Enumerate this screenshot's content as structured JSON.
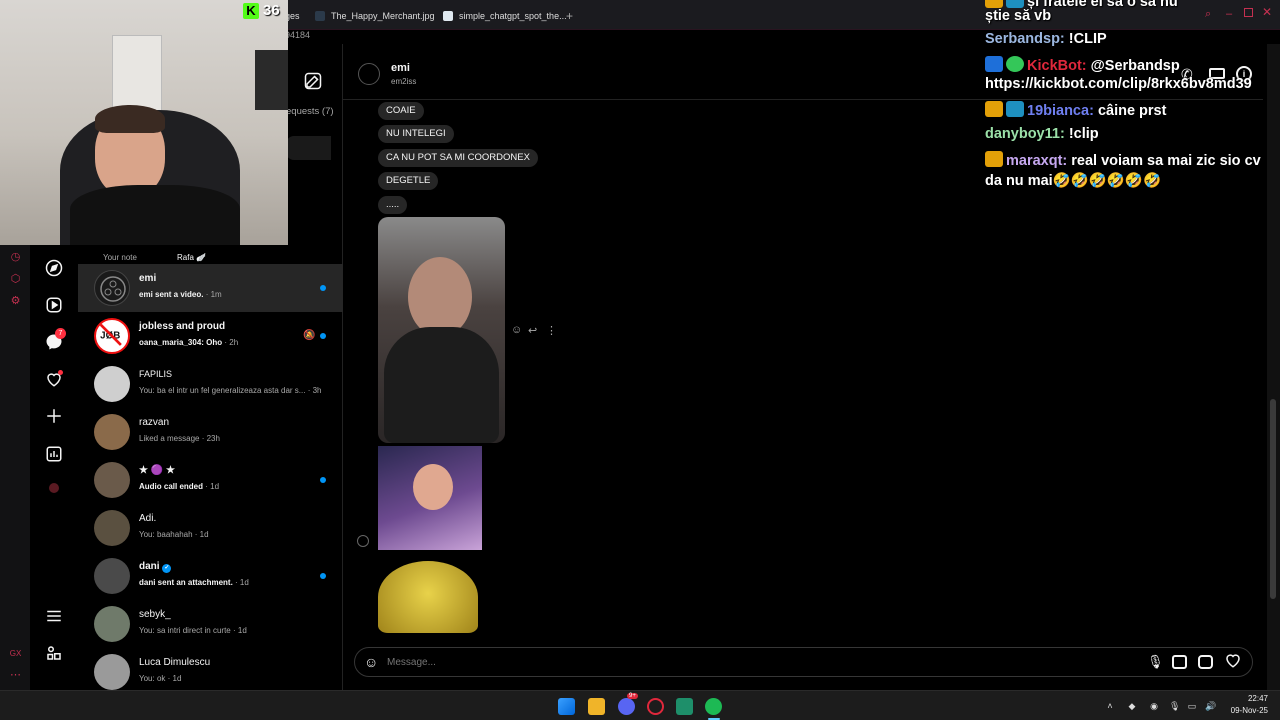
{
  "browser": {
    "tabs": [
      {
        "label": "ges",
        "active": true
      },
      {
        "label": "The_Happy_Merchant.jpg"
      },
      {
        "label": "simple_chatgpt_spot_the..."
      }
    ],
    "new_tab": "+",
    "address_fragment": "94184"
  },
  "webcam": {
    "kick_count": "36"
  },
  "messages_panel": {
    "requests_label": "equests (7)",
    "notes": [
      {
        "label": "Your note"
      },
      {
        "label": "Rafa 🪽"
      }
    ],
    "conversations": [
      {
        "name": "emi",
        "preview": "emi sent a video.",
        "time": "· 1m",
        "unread": true,
        "active": true,
        "bold": true
      },
      {
        "name": "jobless and proud",
        "preview": "oana_maria_304: Oho",
        "time": "· 2h",
        "unread": true,
        "muted": true,
        "bold": true
      },
      {
        "name": "FAPILIS",
        "preview": "You: ba el intr un fel generalizeaza asta dar s...",
        "time": "· 3h"
      },
      {
        "name": "razvan",
        "preview": "Liked a message",
        "time": "· 23h"
      },
      {
        "name": "★ 🟣 ★",
        "preview": "Audio call ended",
        "time": "· 1d",
        "unread": true,
        "bold": true
      },
      {
        "name": "Adi.",
        "preview": "You: baahahah",
        "time": "· 1d"
      },
      {
        "name": "dani",
        "preview": "dani sent an attachment.",
        "time": "· 1d",
        "unread": true,
        "verified": true,
        "bold": true
      },
      {
        "name": "sebyk_",
        "preview": "You: sa intri direct in curte",
        "time": "· 1d"
      },
      {
        "name": "Luca Dimulescu",
        "preview": "You: ok",
        "time": "· 1d"
      }
    ]
  },
  "chat": {
    "name": "emi",
    "username": "em2iss",
    "messages": [
      "COAIE",
      "NU INTELEGI",
      "CA NU POT SA MI COORDONEX",
      "DEGETLE",
      "....."
    ],
    "composer_placeholder": "Message..."
  },
  "stream_chat": [
    {
      "user": "",
      "text": "și fratele ei să o să nu",
      "user_color": "#3b82f6"
    },
    {
      "user": "",
      "text": "știe să vb",
      "user_color": "#ffffff"
    },
    {
      "user": "Serbandsp:",
      "text": "!CLIP",
      "user_color": "#9bb7e0"
    },
    {
      "user": "KickBot:",
      "text": "@Serbandsp",
      "user_color": "#e0283c"
    },
    {
      "user": "",
      "text": "https://kickbot.com/clip/8rkx6bv8md39",
      "user_color": "#ffffff"
    },
    {
      "user": "19bianca:",
      "text": "câine prst",
      "user_color": "#6f7ff0"
    },
    {
      "user": "danyboy11:",
      "text": "!clip",
      "user_color": "#9be0a8"
    },
    {
      "user": "maraxqt:",
      "text": "real voiam sa mai zic sio cv",
      "user_color": "#c6a8f0"
    },
    {
      "user": "",
      "text": "da nu mai🤣🤣🤣🤣🤣🤣",
      "user_color": "#ffffff"
    }
  ],
  "taskbar": {
    "time": "22:47",
    "date": "09-Nov-25",
    "discord_badge": "9+"
  },
  "colors": {
    "accent_blue": "#0095f6",
    "bubble": "#262626",
    "opera_red": "#c43050",
    "kick_green": "#53fc18"
  }
}
